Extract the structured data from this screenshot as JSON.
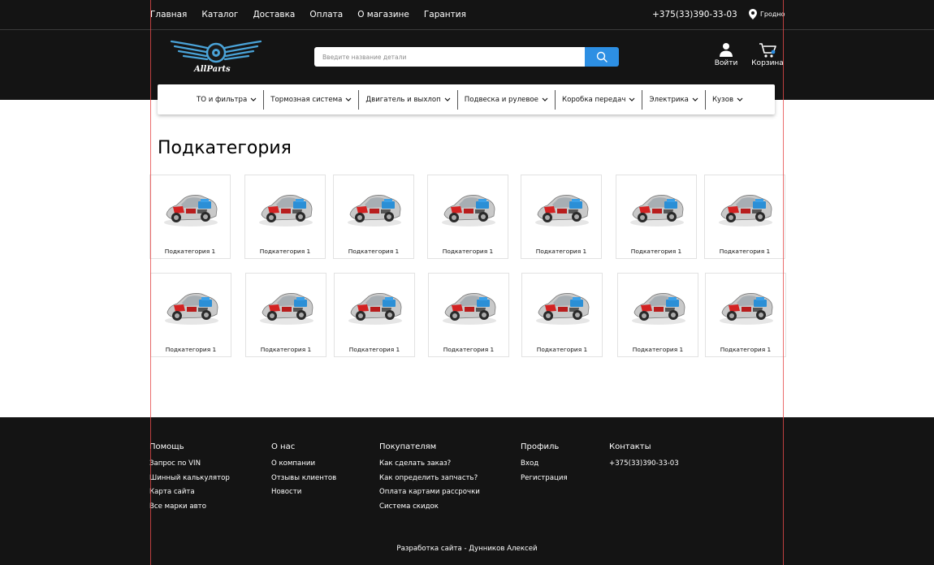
{
  "topnav": {
    "items": [
      "Главная",
      "Каталог",
      "Доставка",
      "Оплата",
      "О магазине",
      "Гарантия"
    ],
    "phone": "+375(33)390-33-03",
    "city": "Гродно"
  },
  "header": {
    "logo_text": "AllParts",
    "search_placeholder": "Введите название детали",
    "login_label": "Войти",
    "cart_label": "Корзина"
  },
  "categories": [
    "ТО и фильтра",
    "Тормозная система",
    "Двигатель и выхлоп",
    "Подвеска и рулевое",
    "Коробка передач",
    "Электрика",
    "Кузов"
  ],
  "main": {
    "title": "Подкатегория",
    "cards": [
      "Подкатегория 1",
      "Подкатегория 1",
      "Подкатегория 1",
      "Подкатегория 1",
      "Подкатегория 1",
      "Подкатегория 1",
      "Подкатегория 1",
      "Подкатегория 1",
      "Подкатегория 1",
      "Подкатегория 1",
      "Подкатегория 1",
      "Подкатегория 1",
      "Подкатегория 1",
      "Подкатегория 1"
    ]
  },
  "footer": {
    "help": {
      "title": "Помощь",
      "links": [
        "Запрос по VIN",
        "Шинный калькулятор",
        "Карта сайта",
        "Все марки авто"
      ]
    },
    "about": {
      "title": "О нас",
      "links": [
        "О компании",
        "Отзывы клиентов",
        "Новости"
      ]
    },
    "buyers": {
      "title": "Покупателям",
      "links": [
        "Как сделать заказ?",
        "Как определить запчасть?",
        "Оплата картами рассрочки",
        "Система скидок"
      ]
    },
    "profile": {
      "title": "Профиль",
      "links": [
        "Вход",
        "Регистрация"
      ]
    },
    "contacts": {
      "title": "Контакты",
      "links": [
        "+375(33)390-33-03"
      ]
    },
    "credit": "Разработка сайта - Дунников Алексей"
  },
  "colors": {
    "dark": "#141414",
    "accent": "#2d8fe3",
    "guide": "#e64a4a"
  }
}
